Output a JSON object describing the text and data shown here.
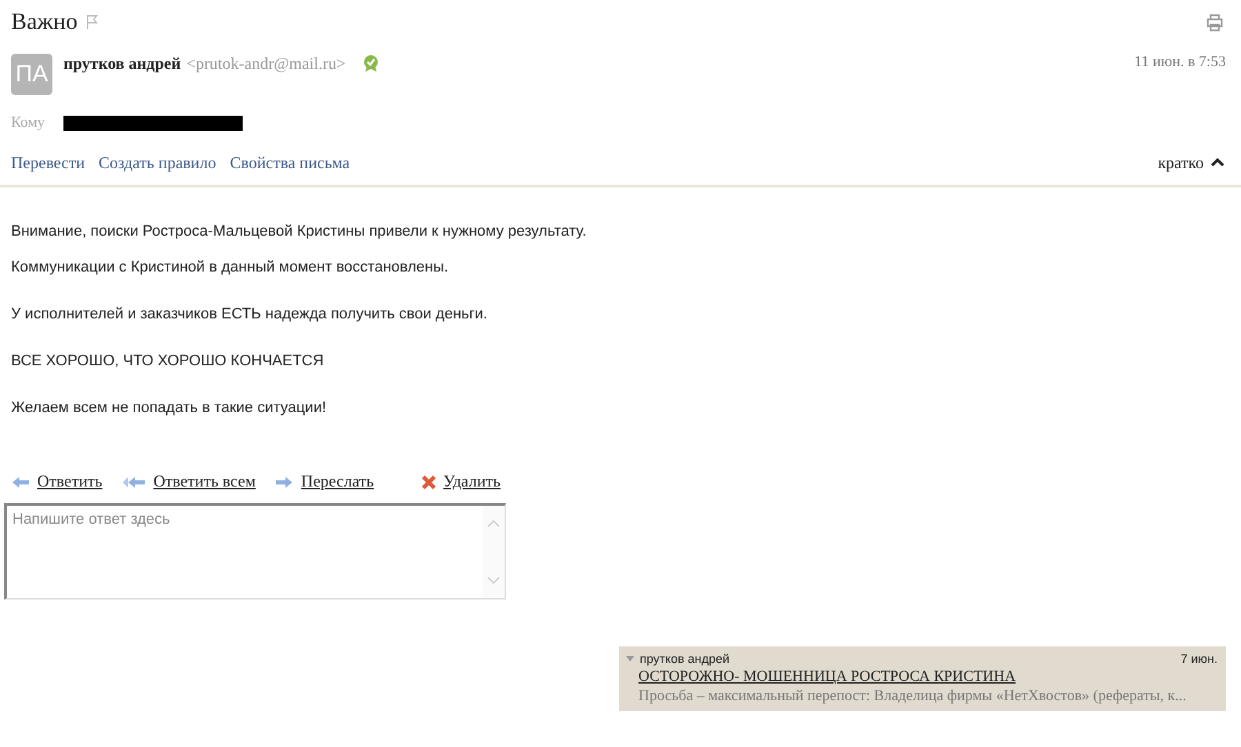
{
  "subject": "Важно",
  "flagged": false,
  "sender": {
    "initials": "ПА",
    "name": "прутков андрей",
    "email": "<prutok-andr@mail.ru>",
    "date": "11 июн. в 7:53"
  },
  "to_label": "Кому",
  "actions": [
    "Перевести",
    "Создать правило",
    "Свойства письма"
  ],
  "view_toggle": {
    "label": "кратко",
    "expanded": true
  },
  "body": [
    "Внимание, поиски Ростроса-Мальцевой Кристины привели к нужному результату.",
    "Коммуникации с Кристиной в данный момент восстановлены.",
    "У исполнителей и заказчиков ЕСТЬ надежда получить свои деньги.",
    "ВСЕ ХОРОШО, ЧТО ХОРОШО КОНЧАЕТСЯ",
    "Желаем всем  не попадать в такие ситуации!"
  ],
  "reply_actions": [
    {
      "kind": "reply",
      "label": "Ответить"
    },
    {
      "kind": "reply_all",
      "label": "Ответить всем"
    },
    {
      "kind": "forward",
      "label": "Переслать"
    },
    {
      "kind": "delete",
      "label": "Удалить"
    }
  ],
  "reply": {
    "placeholder": "Напишите ответ здесь"
  },
  "thread": [
    {
      "sender": "прутков андрей",
      "date": "7 июн.",
      "subject": "ОСТОРОЖНО- МОШЕННИЦА РОСТРОСА КРИСТИНА",
      "snippet": "Просьба – максимальный перепост: Владелица фирмы «НетХвостов» (рефераты, к..."
    }
  ]
}
